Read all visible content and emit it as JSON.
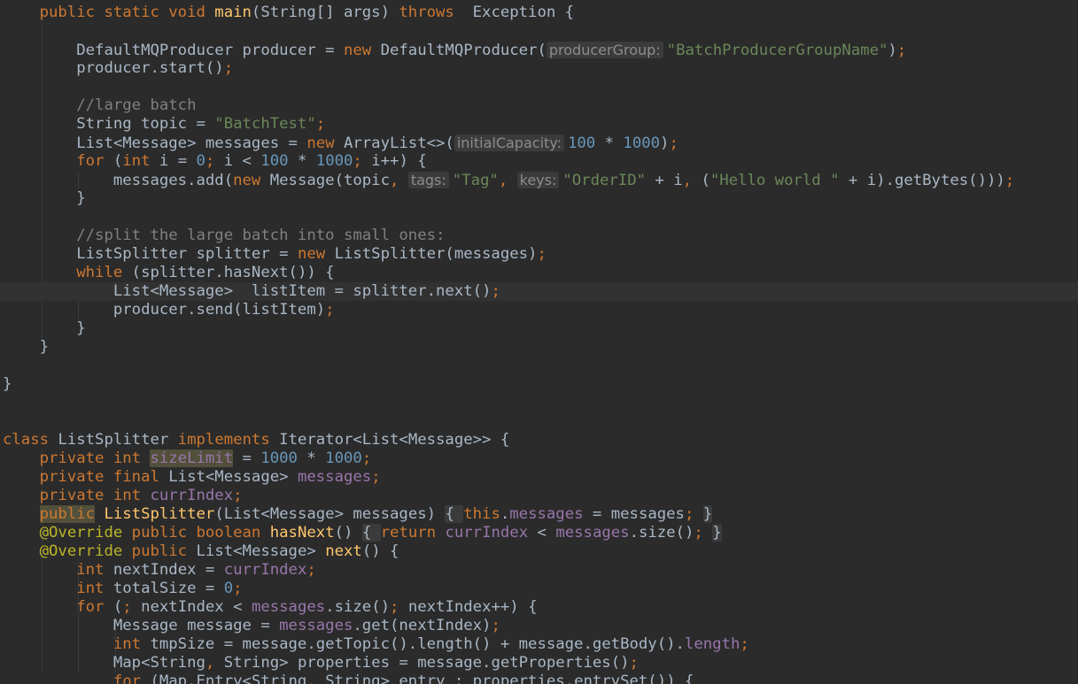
{
  "editor": {
    "current_line": 15,
    "lines": [
      [
        [
          "kw",
          "    public static void "
        ],
        [
          "fn",
          "main"
        ],
        [
          "t",
          "(String[] args) "
        ],
        [
          "kw",
          "throws"
        ],
        [
          "t",
          "  Exception {"
        ]
      ],
      [],
      [
        [
          "t",
          "        DefaultMQProducer producer = "
        ],
        [
          "kw",
          "new "
        ],
        [
          "t",
          "DefaultMQProducer("
        ],
        [
          "hint",
          "producerGroup:"
        ],
        [
          "str",
          "\"BatchProducerGroupName\""
        ],
        [
          "t",
          ")"
        ],
        [
          "kw",
          ";"
        ]
      ],
      [
        [
          "t",
          "        producer.start()"
        ],
        [
          "kw",
          ";"
        ]
      ],
      [],
      [
        [
          "cmt",
          "        //large batch"
        ]
      ],
      [
        [
          "t",
          "        String topic = "
        ],
        [
          "str",
          "\"BatchTest\""
        ],
        [
          "kw",
          ";"
        ]
      ],
      [
        [
          "t",
          "        List<Message> messages = "
        ],
        [
          "kw",
          "new "
        ],
        [
          "t",
          "ArrayList<>("
        ],
        [
          "hint",
          "initialCapacity:"
        ],
        [
          "num",
          "100"
        ],
        [
          "t",
          " * "
        ],
        [
          "num",
          "1000"
        ],
        [
          "t",
          ")"
        ],
        [
          "kw",
          ";"
        ]
      ],
      [
        [
          "kw",
          "        for "
        ],
        [
          "t",
          "("
        ],
        [
          "kw",
          "int "
        ],
        [
          "t",
          "i = "
        ],
        [
          "num",
          "0"
        ],
        [
          "kw",
          "; "
        ],
        [
          "t",
          "i < "
        ],
        [
          "num",
          "100"
        ],
        [
          "t",
          " * "
        ],
        [
          "num",
          "1000"
        ],
        [
          "kw",
          "; "
        ],
        [
          "t",
          "i++) {"
        ]
      ],
      [
        [
          "t",
          "            messages.add("
        ],
        [
          "kw",
          "new "
        ],
        [
          "t",
          "Message(topic"
        ],
        [
          "kw",
          ", "
        ],
        [
          "hint",
          "tags:"
        ],
        [
          "str",
          "\"Tag\""
        ],
        [
          "kw",
          ", "
        ],
        [
          "hint",
          "keys:"
        ],
        [
          "str",
          "\"OrderID\""
        ],
        [
          "t",
          " + i"
        ],
        [
          "kw",
          ", "
        ],
        [
          "t",
          "("
        ],
        [
          "str",
          "\"Hello world \""
        ],
        [
          "t",
          " + i).getBytes()))"
        ],
        [
          "kw",
          ";"
        ]
      ],
      [
        [
          "t",
          "        }"
        ]
      ],
      [],
      [
        [
          "cmt",
          "        //split the large batch into small ones:"
        ]
      ],
      [
        [
          "t",
          "        ListSplitter splitter = "
        ],
        [
          "kw",
          "new "
        ],
        [
          "t",
          "ListSplitter(messages)"
        ],
        [
          "kw",
          ";"
        ]
      ],
      [
        [
          "kw",
          "        while "
        ],
        [
          "t",
          "(splitter.hasNext()) {"
        ]
      ],
      [
        [
          "t",
          "            List<Message>  listItem = splitter.next()"
        ],
        [
          "kw",
          ";"
        ]
      ],
      [
        [
          "t",
          "            producer.send(listItem)"
        ],
        [
          "kw",
          ";"
        ]
      ],
      [
        [
          "t",
          "        }"
        ]
      ],
      [
        [
          "t",
          "    }"
        ]
      ],
      [],
      [
        [
          "t",
          "}"
        ]
      ],
      [],
      [],
      [
        [
          "kw",
          "class "
        ],
        [
          "t",
          "ListSplitter "
        ],
        [
          "kw",
          "implements "
        ],
        [
          "t",
          "Iterator<List<Message>> {"
        ]
      ],
      [
        [
          "kw",
          "    private int "
        ],
        [
          "fldhl",
          "sizeLimit"
        ],
        [
          "t",
          " = "
        ],
        [
          "num",
          "1000"
        ],
        [
          "t",
          " * "
        ],
        [
          "num",
          "1000"
        ],
        [
          "kw",
          ";"
        ]
      ],
      [
        [
          "kw",
          "    private final "
        ],
        [
          "t",
          "List<Message> "
        ],
        [
          "fld",
          "messages"
        ],
        [
          "kw",
          ";"
        ]
      ],
      [
        [
          "kw",
          "    private int "
        ],
        [
          "fld",
          "currIndex"
        ],
        [
          "kw",
          ";"
        ]
      ],
      [
        [
          "t",
          "    "
        ],
        [
          "kwhl",
          "public"
        ],
        [
          "t",
          " "
        ],
        [
          "fn",
          "ListSplitter"
        ],
        [
          "t",
          "(List<Message> messages) "
        ],
        [
          "fold",
          "{ "
        ],
        [
          "kw",
          "this"
        ],
        [
          "t",
          "."
        ],
        [
          "fld",
          "messages"
        ],
        [
          "t",
          " = messages"
        ],
        [
          "kw",
          "; "
        ],
        [
          "fold",
          "}"
        ]
      ],
      [
        [
          "ann",
          "    @Override "
        ],
        [
          "kw",
          "public boolean "
        ],
        [
          "fn",
          "hasNext"
        ],
        [
          "t",
          "() "
        ],
        [
          "fold",
          "{ "
        ],
        [
          "kw",
          "return "
        ],
        [
          "fld",
          "currIndex"
        ],
        [
          "t",
          " < "
        ],
        [
          "fld",
          "messages"
        ],
        [
          "t",
          ".size()"
        ],
        [
          "kw",
          "; "
        ],
        [
          "fold",
          "}"
        ]
      ],
      [
        [
          "ann",
          "    @Override "
        ],
        [
          "kw",
          "public "
        ],
        [
          "t",
          "List<Message> "
        ],
        [
          "fn",
          "next"
        ],
        [
          "t",
          "() {"
        ]
      ],
      [
        [
          "kw",
          "        int "
        ],
        [
          "t",
          "nextIndex = "
        ],
        [
          "fld",
          "currIndex"
        ],
        [
          "kw",
          ";"
        ]
      ],
      [
        [
          "kw",
          "        int "
        ],
        [
          "t",
          "totalSize = "
        ],
        [
          "num",
          "0"
        ],
        [
          "kw",
          ";"
        ]
      ],
      [
        [
          "kw",
          "        for "
        ],
        [
          "t",
          "("
        ],
        [
          "kw",
          "; "
        ],
        [
          "t",
          "nextIndex < "
        ],
        [
          "fld",
          "messages"
        ],
        [
          "t",
          ".size()"
        ],
        [
          "kw",
          "; "
        ],
        [
          "t",
          "nextIndex++) {"
        ]
      ],
      [
        [
          "t",
          "            Message message = "
        ],
        [
          "fld",
          "messages"
        ],
        [
          "t",
          ".get(nextIndex)"
        ],
        [
          "kw",
          ";"
        ]
      ],
      [
        [
          "kw",
          "            int "
        ],
        [
          "t",
          "tmpSize = message.getTopic().length() + message.getBody()."
        ],
        [
          "fld",
          "length"
        ],
        [
          "kw",
          ";"
        ]
      ],
      [
        [
          "t",
          "            Map<String"
        ],
        [
          "kw",
          ", "
        ],
        [
          "t",
          "String> properties = message.getProperties()"
        ],
        [
          "kw",
          ";"
        ]
      ],
      [
        [
          "kw",
          "            for "
        ],
        [
          "t",
          "(Map.Entry<String"
        ],
        [
          "kw",
          ", "
        ],
        [
          "t",
          "String> entry : properties.entrySet()) {"
        ]
      ]
    ]
  }
}
